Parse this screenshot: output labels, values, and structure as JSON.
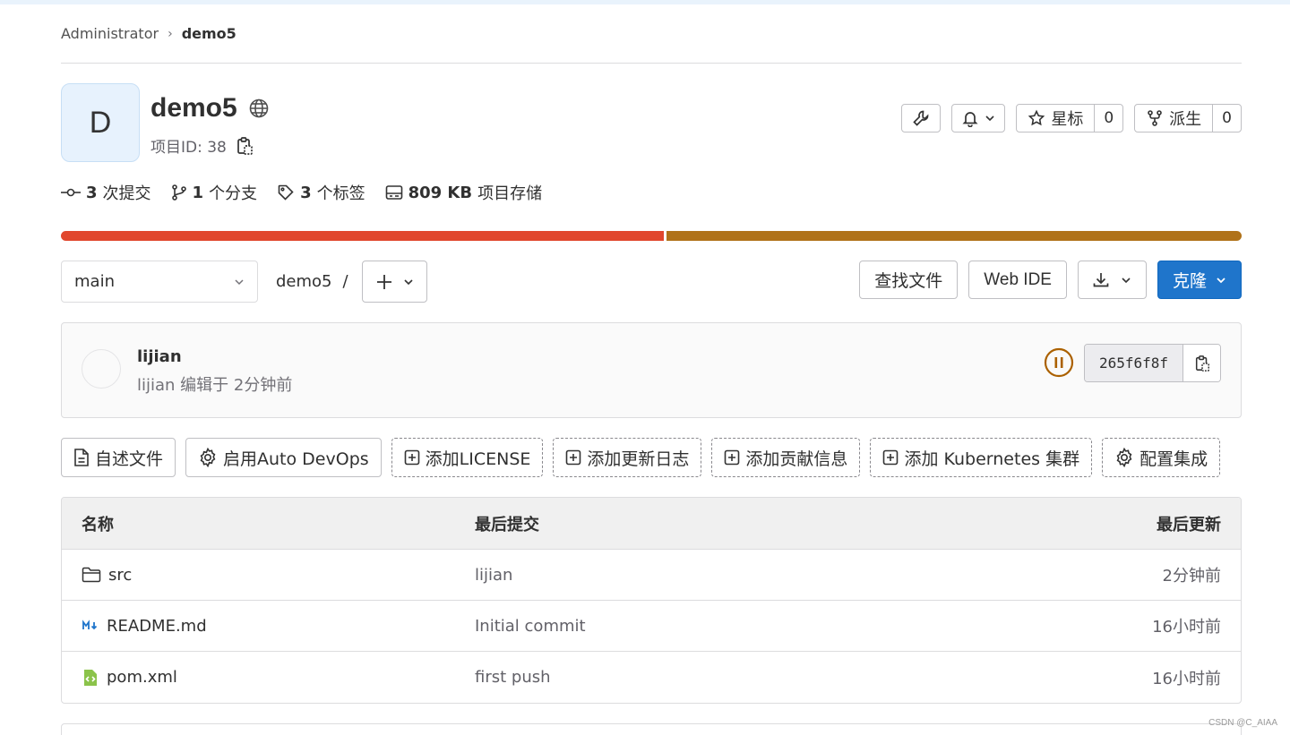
{
  "breadcrumb": {
    "owner": "Administrator",
    "project": "demo5"
  },
  "project": {
    "avatar_letter": "D",
    "name": "demo5",
    "id_label": "项目ID: 38"
  },
  "header_actions": {
    "star_label": "星标",
    "star_count": "0",
    "fork_label": "派生",
    "fork_count": "0"
  },
  "stats": {
    "commits_count": "3",
    "commits_label": "次提交",
    "branches_count": "1",
    "branches_label": "个分支",
    "tags_count": "3",
    "tags_label": "个标签",
    "storage_size": "809 KB",
    "storage_label": "项目存储"
  },
  "language_bar": [
    {
      "color": "#e1472d",
      "share": 0.512
    },
    {
      "color": "#b07219",
      "share": 0.488
    }
  ],
  "toolbar": {
    "branch": "main",
    "path_project": "demo5",
    "path_sep": "/",
    "find_file": "查找文件",
    "web_ide": "Web IDE",
    "clone": "克隆"
  },
  "last_commit": {
    "title": "lijian",
    "meta": "lijian 编辑于 2分钟前",
    "sha": "265f6f8f",
    "pipeline_color": "#ab6100"
  },
  "quick_links": [
    {
      "label": "自述文件",
      "icon": "file-icon",
      "dashed": false
    },
    {
      "label": "启用Auto DevOps",
      "icon": "gear-icon",
      "dashed": false
    },
    {
      "label": "添加LICENSE",
      "icon": "plus-square-icon",
      "dashed": true
    },
    {
      "label": "添加更新日志",
      "icon": "plus-square-icon",
      "dashed": true
    },
    {
      "label": "添加贡献信息",
      "icon": "plus-square-icon",
      "dashed": true
    },
    {
      "label": "添加 Kubernetes 集群",
      "icon": "plus-square-icon",
      "dashed": true
    },
    {
      "label": "配置集成",
      "icon": "gear-icon",
      "dashed": true
    }
  ],
  "file_table": {
    "headers": {
      "name": "名称",
      "last_commit": "最后提交",
      "last_update": "最后更新"
    },
    "rows": [
      {
        "name": "src",
        "icon": "folder-icon",
        "commit": "lijian",
        "updated": "2分钟前"
      },
      {
        "name": "README.md",
        "icon": "markdown-icon",
        "commit": "Initial commit",
        "updated": "16小时前"
      },
      {
        "name": "pom.xml",
        "icon": "xml-file-icon",
        "commit": "first push",
        "updated": "16小时前"
      }
    ]
  },
  "watermark": "CSDN @C_AIAA"
}
